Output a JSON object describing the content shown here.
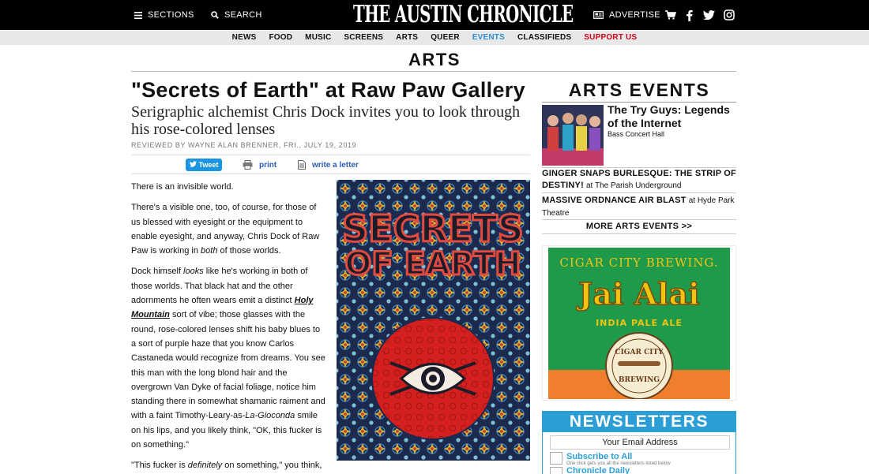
{
  "topbar": {
    "sections_label": "SECTIONS",
    "search_label": "SEARCH",
    "logo_text": "THE AUSTIN CHRONICLE",
    "advertise_label": "ADVERTISE"
  },
  "nav": {
    "items": [
      "NEWS",
      "FOOD",
      "MUSIC",
      "SCREENS",
      "ARTS",
      "QUEER",
      "EVENTS",
      "CLASSIFIEDS",
      "SUPPORT US"
    ],
    "active_color": "#2d8fd5",
    "support_color": "#d0021b"
  },
  "section_title": "ARTS",
  "article": {
    "headline": "\"Secrets of Earth\" at Raw Paw Gallery",
    "dek": "Serigraphic alchemist Chris Dock invites you to look through his rose-colored lenses",
    "byline_prefix": "REVIEWED BY WAYNE ALAN BRENNER, ",
    "byline_date": "FRI., JULY 19, 2019",
    "tweet_label": "Tweet",
    "print_label": "print",
    "letter_label": "write a letter",
    "p1": "There is an invisible world.",
    "p2_a": "There's a visible one, too, of course, for those of us blessed with eyesight or the equipment to enable eyesight, and anyway, Chris Dock of Raw Paw is working in ",
    "p2_em": "both",
    "p2_b": " of those worlds.",
    "p3_a": "Dock himself ",
    "p3_em1": "looks",
    "p3_b": " like he's working in both of those worlds. That black hat and the other adornments he often wears emit a distinct ",
    "p3_link": "Holy Mountain",
    "p3_c": " sort of vibe; those glasses with the round, rose-colored lenses shift his baby blues to a sort of purple haze that you know Carlos Castaneda would recognize from dreams. You see this man with the long blond hair and the overgrown Van Dyke of facial foliage, notice him standing there in somewhat shamanic raiment and with a faint Timothy-Leary-as-",
    "p3_em2": "La-Gioconda",
    "p3_d": " smile on his lips, and you likely think, \"OK, this fucker is on something.\"",
    "p4_a": "\"This fucker is ",
    "p4_em": "definitely",
    "p4_b": " on something,\" you think,",
    "poster_line1": "SECRETS",
    "poster_line2": "OF EARTH"
  },
  "sidebar": {
    "title": "ARTS EVENTS",
    "event1_title": "The Try Guys: Legends of the Internet",
    "event1_venue": "Bass Concert Hall",
    "event2_title": "GINGER SNAPS BURLESQUE: THE STRIP OF DESTINY!",
    "event2_venue": "at The Parish Underground",
    "event3_title": "MASSIVE ORDNANCE AIR BLAST",
    "event3_venue": "at Hyde Park Theatre",
    "more_label": "MORE ARTS EVENTS >>"
  },
  "ad": {
    "brand": "CIGAR CITY BREWING.",
    "product": "Jai Alai",
    "style": "INDIA PALE ALE",
    "badge_line1": "CIGAR CITY",
    "badge_line2": "BREWING",
    "bg_color": "#1f9a4a",
    "accent_color": "#f1c40f"
  },
  "newsletters": {
    "title": "NEWSLETTERS",
    "email_placeholder": "Your Email Address",
    "option1": "Subscribe to All",
    "option1_sub": "One click gets you all the newsletters listed below",
    "option2": "Chronicle Daily"
  }
}
